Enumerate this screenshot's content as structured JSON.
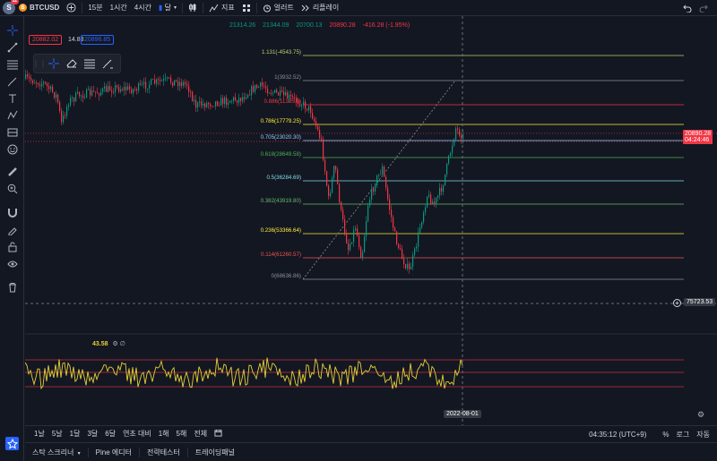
{
  "topbar": {
    "avatar_letter": "S",
    "avatar_badge": "11",
    "coin_glyph": "B",
    "symbol": "BTCUSD",
    "timeframes": [
      "15분",
      "1시간",
      "4시간"
    ],
    "candle_type_label": "달",
    "indicators_label": "지표",
    "alert_label": "얼러트",
    "replay_label": "리플레이"
  },
  "ohlc": {
    "open": "21314.26",
    "high": "21344.09",
    "low": "20700.13",
    "close": "20890.28",
    "change": "-416.28 (-1.95%)"
  },
  "price_tags": {
    "sell": "20882.02",
    "spread": "14.83",
    "buy": "20896.85",
    "last_price": "20890.28",
    "countdown": "04:24:46",
    "crosshair_price": "75723.53",
    "crosshair_date": "2022-08-01"
  },
  "fib_levels": [
    {
      "label": "1.131(-4543.75)",
      "color": "#b7d46b"
    },
    {
      "label": "1(3932.52)",
      "color": "#8b8f9b"
    },
    {
      "label": "0.886(11395.8)",
      "color": "#f23645"
    },
    {
      "label": "0.786(17779.25)",
      "color": "#ffeb3b"
    },
    {
      "label": "0.705(23020.30)",
      "color": "#90caf9"
    },
    {
      "label": "0.618(28649.58)",
      "color": "#4caf50"
    },
    {
      "label": "0.5(36284.69)",
      "color": "#80deea"
    },
    {
      "label": "0.382(43919.80)",
      "color": "#66bb6a"
    },
    {
      "label": "0.236(53366.64)",
      "color": "#ffeb3b"
    },
    {
      "label": "0.114(61260.57)",
      "color": "#ef5350"
    },
    {
      "label": "0(68636.86)",
      "color": "#8b8f9b"
    }
  ],
  "oscillator": {
    "value": "43.58",
    "icons": "⚙ ∅"
  },
  "timeframe_bar": {
    "ranges": [
      "1날",
      "5날",
      "1달",
      "3달",
      "6달",
      "연초 대비",
      "1해",
      "5해",
      "전체"
    ],
    "clock": "04:35:12 (UTC+9)",
    "percent_label": "%",
    "log_label": "로그",
    "auto_label": "자동"
  },
  "bottom_tabs": [
    "스탁 스크리너",
    "Pine 에디터",
    "전략테스터",
    "트레이딩패널"
  ],
  "colors": {
    "up": "#089981",
    "down": "#f23645",
    "accent": "#2962ff",
    "oscillator": "#e6cf37"
  }
}
